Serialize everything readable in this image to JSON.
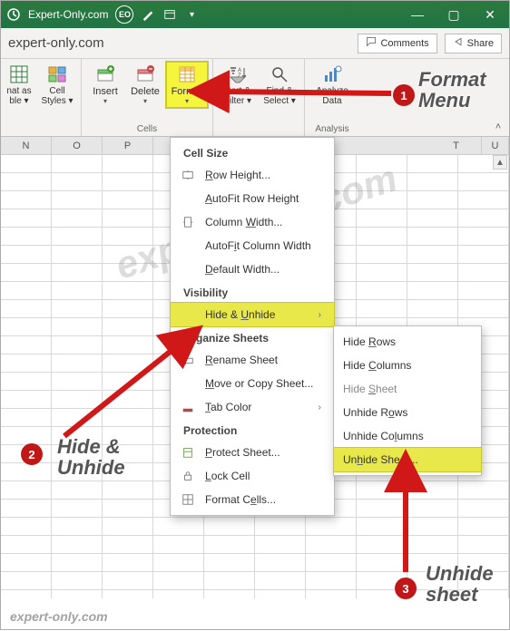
{
  "titlebar": {
    "doc_title": "Expert-Only.com",
    "user_initials": "EO",
    "minus": "—",
    "max": "▢",
    "close": "✕"
  },
  "qa": {
    "site": "expert-only.com",
    "comments": "Comments",
    "share": "Share"
  },
  "ribbon": {
    "format_as": "nat as\nble ▾",
    "cell_styles": "Cell\nStyles ▾",
    "insert": "Insert",
    "delete": "Delete",
    "format": "Format",
    "sort_filter": "Sort &\nFilter ▾",
    "find_select": "Find &\nSelect ▾",
    "analyze": "Analyze\nData",
    "group_cells": "Cells",
    "group_analysis": "Analysis",
    "caret": "▾",
    "collapse": "˄"
  },
  "columns": [
    "N",
    "O",
    "P",
    "T",
    "U"
  ],
  "menu1": {
    "cell_size": "Cell Size",
    "row_height": "Row Height...",
    "autofit_row": "AutoFit Row Height",
    "col_width": "Column Width...",
    "autofit_col": "AutoFit Column Width",
    "default_width": "Default Width...",
    "visibility": "Visibility",
    "hide_unhide": "Hide & Unhide",
    "organize": "Organize Sheets",
    "rename": "Rename Sheet",
    "move_copy": "Move or Copy Sheet...",
    "tab_color": "Tab Color",
    "protection": "Protection",
    "protect_sheet": "Protect Sheet...",
    "lock_cell": "Lock Cell",
    "format_cells": "Format Cells...",
    "arrow": "›"
  },
  "menu2": {
    "hide_rows": "Hide Rows",
    "hide_cols": "Hide Columns",
    "hide_sheet": "Hide Sheet",
    "unhide_rows": "Unhide Rows",
    "unhide_cols": "Unhide Columns",
    "unhide_sheet": "Unhide Sheet..."
  },
  "annotations": {
    "format_menu_1": "Format",
    "format_menu_2": "Menu",
    "hide_unhide_1": "Hide &",
    "hide_unhide_2": "Unhide",
    "unhide_sheet_1": "Unhide",
    "unhide_sheet_2": "sheet",
    "b1": "1",
    "b2": "2",
    "b3": "3"
  },
  "watermark": "expert-only.com",
  "footer_wm": "expert-only.com",
  "scroll_up": "▲"
}
